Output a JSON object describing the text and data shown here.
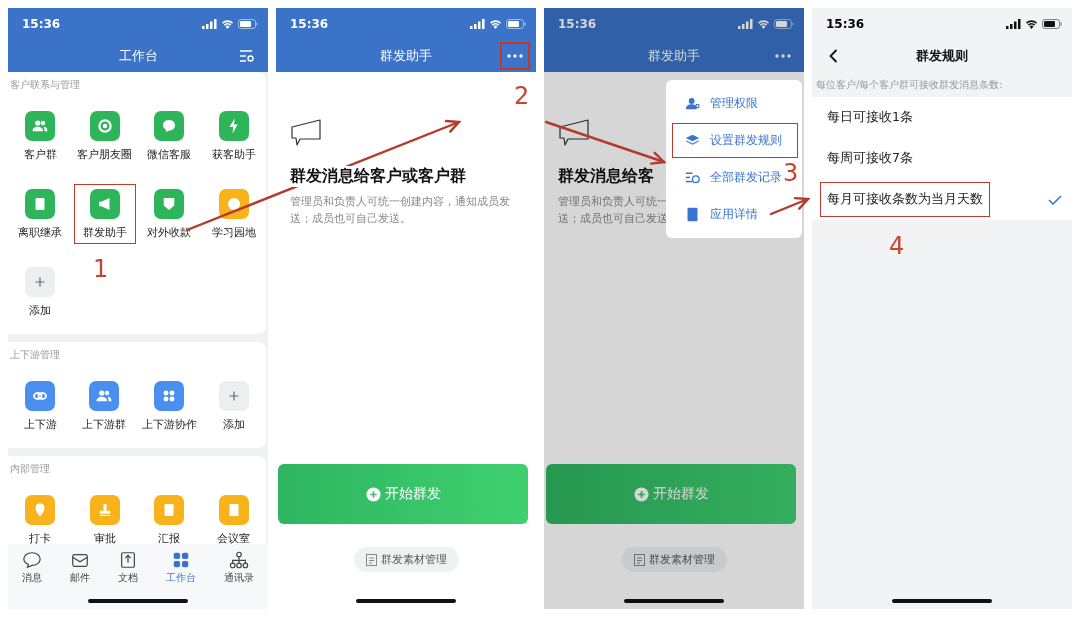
{
  "panels": [
    {
      "kind": "workbench",
      "status_time": "15:36",
      "title": "工作台",
      "sections": [
        {
          "title": "客户联系与管理",
          "items": [
            {
              "label": "客户群",
              "kind": "app",
              "color": "#2eb55a",
              "highlighted": false
            },
            {
              "label": "客户朋友圈",
              "kind": "app",
              "color": "#2eb55a",
              "highlighted": false
            },
            {
              "label": "微信客服",
              "kind": "app",
              "color": "#2eb55a",
              "highlighted": false
            },
            {
              "label": "获客助手",
              "kind": "app",
              "color": "#2eb55a",
              "highlighted": false
            },
            {
              "label": "离职继承",
              "kind": "app",
              "color": "#2eb55a",
              "highlighted": false
            },
            {
              "label": "群发助手",
              "kind": "app",
              "color": "#2eb55a",
              "highlighted": true
            },
            {
              "label": "对外收款",
              "kind": "app",
              "color": "#2eb55a",
              "highlighted": false
            },
            {
              "label": "学习园地",
              "kind": "app",
              "color": "#f8b21c",
              "highlighted": false
            },
            {
              "label": "添加",
              "kind": "add",
              "highlighted": false
            }
          ]
        },
        {
          "title": "上下游管理",
          "items": [
            {
              "label": "上下游",
              "kind": "app",
              "color": "#4a8ff0",
              "highlighted": false
            },
            {
              "label": "上下游群",
              "kind": "app",
              "color": "#4a8ff0",
              "highlighted": false
            },
            {
              "label": "上下游协作",
              "kind": "app",
              "color": "#4a8ff0",
              "highlighted": false
            },
            {
              "label": "添加",
              "kind": "add",
              "highlighted": false
            }
          ]
        },
        {
          "title": "内部管理",
          "items": [
            {
              "label": "打卡",
              "kind": "app",
              "color": "#f8b21c",
              "highlighted": false
            },
            {
              "label": "审批",
              "kind": "app",
              "color": "#f8b21c",
              "highlighted": false
            },
            {
              "label": "汇报",
              "kind": "app",
              "color": "#f8b21c",
              "highlighted": false
            },
            {
              "label": "会议室",
              "kind": "app",
              "color": "#f8b21c",
              "highlighted": false
            }
          ]
        }
      ],
      "tabs": [
        {
          "label": "消息",
          "selected": false
        },
        {
          "label": "邮件",
          "selected": false
        },
        {
          "label": "文档",
          "selected": false
        },
        {
          "label": "工作台",
          "selected": true
        },
        {
          "label": "通讯录",
          "selected": false
        }
      ]
    },
    {
      "kind": "broadcast",
      "status_time": "15:36",
      "title": "群发助手",
      "more_highlighted": true,
      "heading": "群发消息给客户或客户群",
      "description": [
        "管理员和负责人可统一创建内容，通知成员发",
        "送；成员也可自己发送。"
      ],
      "primary_button": "开始群发",
      "secondary_button": "群发素材管理",
      "dimmed": false
    },
    {
      "kind": "broadcast",
      "status_time": "15:36",
      "title": "群发助手",
      "more_highlighted": false,
      "heading": "群发消息给客",
      "description": [
        "管理员和负责人可统一",
        "送；成员也可自己发送"
      ],
      "primary_button": "开始群发",
      "secondary_button": "群发素材管理",
      "dimmed": true,
      "menu": [
        {
          "label": "管理权限",
          "highlighted": false
        },
        {
          "label": "设置群发规则",
          "highlighted": true
        },
        {
          "label": "全部群发记录",
          "highlighted": false
        },
        {
          "label": "应用详情",
          "highlighted": false
        }
      ]
    },
    {
      "kind": "rules",
      "status_time": "15:36",
      "title": "群发规则",
      "caption": "每位客户/每个客户群可接收群发消息条数:",
      "options": [
        {
          "label": "每日可接收1条",
          "selected": false,
          "highlighted": false
        },
        {
          "label": "每周可接收7条",
          "selected": false,
          "highlighted": false
        },
        {
          "label": "每月可接收条数为当月天数",
          "selected": true,
          "highlighted": true
        }
      ]
    }
  ],
  "step_labels": [
    "1",
    "2",
    "3",
    "4"
  ]
}
